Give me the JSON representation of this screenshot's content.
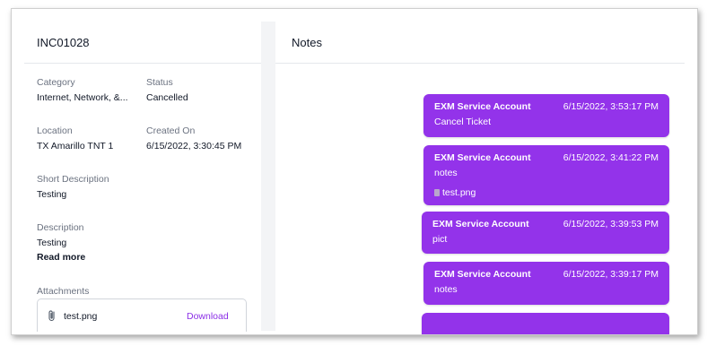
{
  "incident": {
    "id": "INC01028",
    "fields": {
      "category_label": "Category",
      "category_value": "Internet, Network, &...",
      "status_label": "Status",
      "status_value": "Cancelled",
      "location_label": "Location",
      "location_value": "TX Amarillo TNT 1",
      "created_label": "Created On",
      "created_value": "6/15/2022, 3:30:45 PM",
      "short_desc_label": "Short Description",
      "short_desc_value": "Testing",
      "desc_label": "Description",
      "desc_value": "Testing",
      "read_more": "Read more",
      "attachments_label": "Attachments"
    },
    "attachment": {
      "name": "test.png",
      "action": "Download",
      "icon": "paperclip-icon"
    }
  },
  "notes": {
    "title": "Notes",
    "items": [
      {
        "author": "EXM Service Account",
        "time": "6/15/2022, 3:53:17 PM",
        "text": "Cancel Ticket"
      },
      {
        "author": "EXM Service Account",
        "time": "6/15/2022, 3:41:22 PM",
        "text": "notes",
        "file": "test.png"
      },
      {
        "author": "EXM Service Account",
        "time": "6/15/2022, 3:39:53 PM",
        "text": "pict"
      },
      {
        "author": "EXM Service Account",
        "time": "6/15/2022, 3:39:17 PM",
        "text": "notes"
      }
    ]
  },
  "colors": {
    "accent": "#9333ea",
    "link": "#8b2fe6"
  }
}
